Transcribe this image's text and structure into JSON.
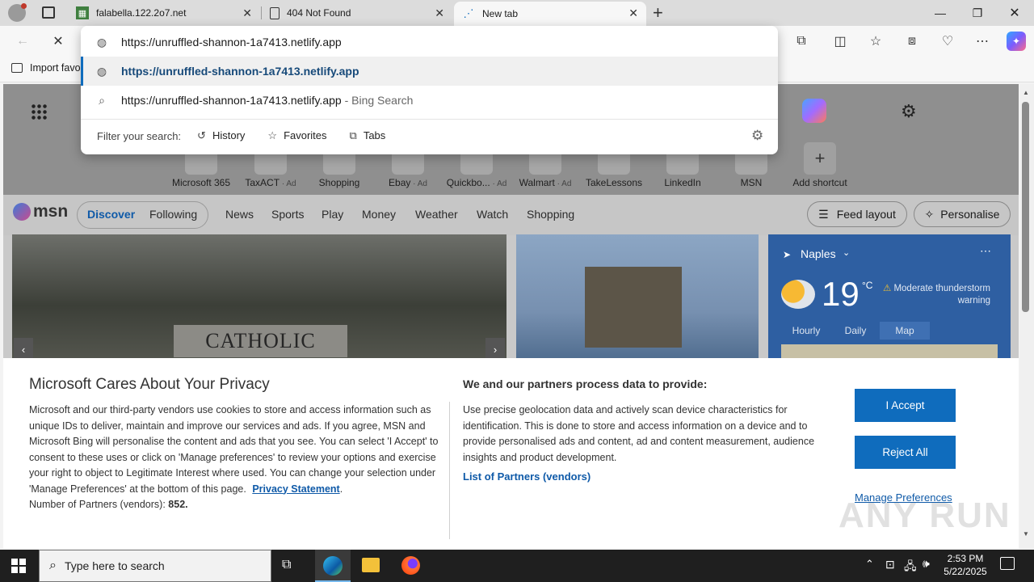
{
  "tabs": [
    {
      "title": "falabella.122.2o7.net",
      "icon": "page-icon"
    },
    {
      "title": "404 Not Found",
      "icon": "document-icon"
    },
    {
      "title": "New tab",
      "icon": "loading-icon"
    }
  ],
  "address": {
    "value": "https://unruffled-shannon-1a7413.netlify.app",
    "suggestion_primary": "https://unruffled-shannon-1a7413.netlify.app",
    "suggestion_search": "https://unruffled-shannon-1a7413.netlify.app",
    "suggestion_search_suffix": " - Bing Search",
    "filter_label": "Filter your search:",
    "filters": [
      "History",
      "Favorites",
      "Tabs"
    ]
  },
  "favorites_bar": {
    "import_label": "Import favo"
  },
  "quick_links": [
    "Microsoft 365",
    "TaxACT",
    "Shopping",
    "Ebay",
    "Quickbo...",
    "Walmart",
    "TakeLessons",
    "LinkedIn",
    "MSN",
    "Add shortcut"
  ],
  "quick_link_ad": "Ad",
  "msn": {
    "logo": "msn",
    "tabs": [
      "Discover",
      "Following"
    ],
    "nav": [
      "News",
      "Sports",
      "Play",
      "Money",
      "Weather",
      "Watch",
      "Shopping"
    ],
    "feed_layout": "Feed layout",
    "personalise": "Personalise",
    "story_sign": "CATHOLIC",
    "weather": {
      "city": "Naples",
      "temp": "19",
      "unit": "°C",
      "alert": "Moderate thunderstorm warning",
      "tabs": [
        "Hourly",
        "Daily",
        "Map"
      ]
    }
  },
  "privacy": {
    "title": "Microsoft Cares About Your Privacy",
    "body": "Microsoft and our third-party vendors use cookies to store and access information such as unique IDs to deliver, maintain and improve our services and ads. If you agree, MSN and Microsoft Bing will personalise the content and ads that you see. You can select 'I Accept' to consent to these uses or click on 'Manage preferences' to review your options and exercise your right to object to Legitimate Interest where used.  You can change your selection under 'Manage Preferences' at the bottom of this page.",
    "link": "Privacy Statement",
    "partners_label": "Number of Partners (vendors):",
    "partners_count": "852.",
    "col2_title": "We and our partners process data to provide:",
    "col2_body": "Use precise geolocation data and actively scan device characteristics for identification. This is done to store and access information on a device and to provide personalised ads and content, ad and content measurement, audience insights and product development.",
    "col2_link": "List of Partners (vendors)",
    "accept": "I Accept",
    "reject": "Reject All",
    "manage": "Manage Preferences"
  },
  "taskbar": {
    "search_placeholder": "Type here to search",
    "time": "2:53 PM",
    "date": "5/22/2025"
  },
  "watermark": "ANY RUN",
  "colors": {
    "accent": "#0f6cbd",
    "taskbar": "#1f1f1f"
  }
}
